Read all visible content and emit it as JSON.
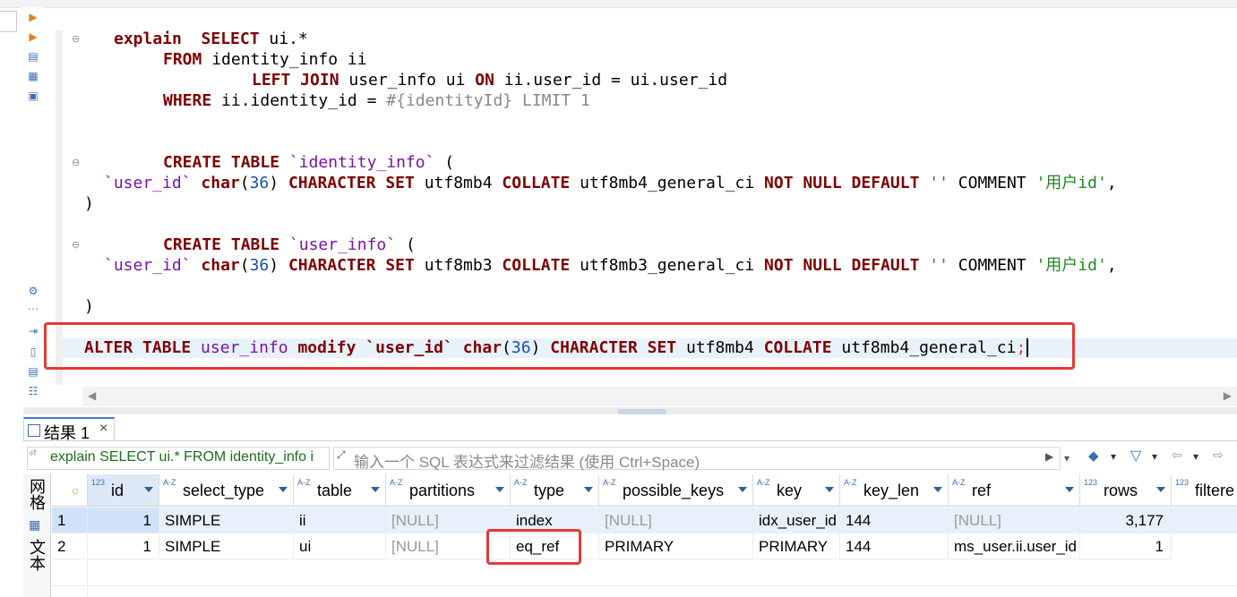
{
  "editor": {
    "lines": {
      "l1": {
        "kw1": "explain",
        "kw2": "SELECT",
        "rest": " ui.*"
      },
      "l2": {
        "kw": "FROM",
        "rest": " identity_info ii"
      },
      "l3": {
        "kw1": "LEFT JOIN",
        "mid": " user_info ui ",
        "kw2": "ON",
        "rest": " ii.user_id = ui.user_id"
      },
      "l4": {
        "kw": "WHERE",
        "rest": " ii.identity_id = ",
        "param": "#{identityId} LIMIT 1"
      },
      "l5": {
        "kw": "CREATE TABLE",
        "id": "`identity_info`",
        "rest": " ("
      },
      "l6": {
        "id": "`user_id`",
        "kw1": "char",
        "p1": "(",
        "num": "36",
        "p2": ") ",
        "kw2": "CHARACTER SET",
        "cs": " utf8mb4 ",
        "kw3": "COLLATE",
        "col": " utf8mb4_general_ci ",
        "kw4": "NOT NULL DEFAULT",
        "s1": " '' ",
        "cm": "COMMENT",
        "s2": " '用户id'",
        "end": ","
      },
      "l7": {
        "text": ")"
      },
      "l8": {
        "kw": "CREATE TABLE",
        "id": "`user_info`",
        "rest": " ("
      },
      "l9": {
        "id": "`user_id`",
        "kw1": "char",
        "p1": "(",
        "num": "36",
        "p2": ") ",
        "kw2": "CHARACTER SET",
        "cs": " utf8mb3 ",
        "kw3": "COLLATE",
        "col": " utf8mb3_general_ci ",
        "kw4": "NOT NULL DEFAULT",
        "s1": " '' ",
        "cm": "COMMENT",
        "s2": " '用户id'",
        "end": ","
      },
      "l10": {
        "text": ")"
      },
      "l11": {
        "kw1": "ALTER TABLE",
        "id": " user_info ",
        "kw2": "modify",
        "col": " `user_id` ",
        "kw3": "char",
        "p1": "(",
        "num": "36",
        "p2": ") ",
        "kw4": "CHARACTER SET",
        "cs": " utf8mb4 ",
        "kw5": "COLLATE",
        "coll": " utf8mb4_general_ci",
        "semi": ";"
      }
    }
  },
  "results": {
    "tab_label": "结果 1",
    "tab_close": "×",
    "query_text": "explain SELECT ui.* FROM identity_info i",
    "filter_placeholder": "输入一个 SQL 表达式来过滤结果 (使用 Ctrl+Space)",
    "vertical_tabs": [
      "网格",
      "文本"
    ],
    "columns": [
      {
        "type": "123",
        "name": "id"
      },
      {
        "type": "A-Z",
        "name": "select_type"
      },
      {
        "type": "A-Z",
        "name": "table"
      },
      {
        "type": "A-Z",
        "name": "partitions"
      },
      {
        "type": "A-Z",
        "name": "type"
      },
      {
        "type": "A-Z",
        "name": "possible_keys"
      },
      {
        "type": "A-Z",
        "name": "key"
      },
      {
        "type": "A-Z",
        "name": "key_len"
      },
      {
        "type": "A-Z",
        "name": "ref"
      },
      {
        "type": "123",
        "name": "rows"
      },
      {
        "type": "123",
        "name": "filtere"
      }
    ],
    "rows": [
      {
        "num": "1",
        "id": "1",
        "select_type": "SIMPLE",
        "table": "ii",
        "partitions": "[NULL]",
        "type": "index",
        "possible_keys": "[NULL]",
        "key": "idx_user_id",
        "key_len": "144",
        "ref": "[NULL]",
        "rows": "3,177"
      },
      {
        "num": "2",
        "id": "1",
        "select_type": "SIMPLE",
        "table": "ui",
        "partitions": "[NULL]",
        "type": "eq_ref",
        "possible_keys": "PRIMARY",
        "key": "PRIMARY",
        "key_len": "144",
        "ref": "ms_user.ii.user_id",
        "rows": "1"
      }
    ]
  },
  "colors": {
    "keyword": "#7f0000",
    "identifier": "#7a12a6",
    "number": "#1a4fb0",
    "string": "#228822",
    "highlight": "#e53935"
  }
}
